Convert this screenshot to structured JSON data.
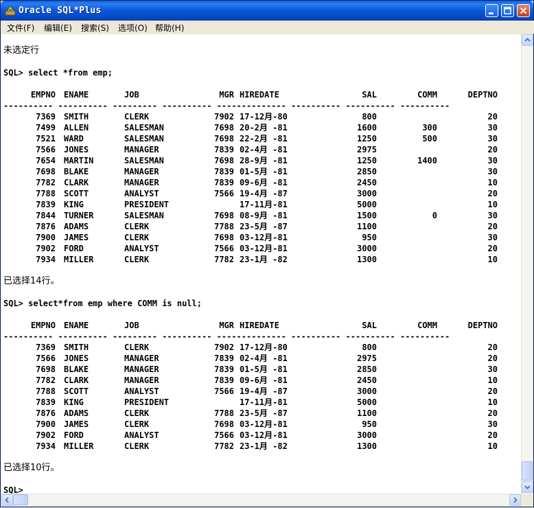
{
  "window": {
    "title": "Oracle SQL*Plus"
  },
  "menu": [
    {
      "label": "文件(F)"
    },
    {
      "label": "编辑(E)"
    },
    {
      "label": "搜索(S)"
    },
    {
      "label": "选项(O)"
    },
    {
      "label": "帮助(H)"
    }
  ],
  "console": {
    "no_rows_msg": "未选定行",
    "query1": "SQL> select *from emp;",
    "query2": "SQL> select*from emp where COMM is null;",
    "prompt": "SQL>",
    "separator": "---------- ---------- --------- ---------- -------------- ---------- ---------- ----------",
    "columns": [
      "EMPNO",
      "ENAME",
      "JOB",
      "MGR",
      "HIREDATE",
      "SAL",
      "COMM",
      "DEPTNO"
    ],
    "result1": [
      [
        "7369",
        "SMITH",
        "CLERK",
        "7902",
        "17-12月-80",
        "800",
        "",
        "20"
      ],
      [
        "7499",
        "ALLEN",
        "SALESMAN",
        "7698",
        "20-2月 -81",
        "1600",
        "300",
        "30"
      ],
      [
        "7521",
        "WARD",
        "SALESMAN",
        "7698",
        "22-2月 -81",
        "1250",
        "500",
        "30"
      ],
      [
        "7566",
        "JONES",
        "MANAGER",
        "7839",
        "02-4月 -81",
        "2975",
        "",
        "20"
      ],
      [
        "7654",
        "MARTIN",
        "SALESMAN",
        "7698",
        "28-9月 -81",
        "1250",
        "1400",
        "30"
      ],
      [
        "7698",
        "BLAKE",
        "MANAGER",
        "7839",
        "01-5月 -81",
        "2850",
        "",
        "30"
      ],
      [
        "7782",
        "CLARK",
        "MANAGER",
        "7839",
        "09-6月 -81",
        "2450",
        "",
        "10"
      ],
      [
        "7788",
        "SCOTT",
        "ANALYST",
        "7566",
        "19-4月 -87",
        "3000",
        "",
        "20"
      ],
      [
        "7839",
        "KING",
        "PRESIDENT",
        "",
        "17-11月-81",
        "5000",
        "",
        "10"
      ],
      [
        "7844",
        "TURNER",
        "SALESMAN",
        "7698",
        "08-9月 -81",
        "1500",
        "0",
        "30"
      ],
      [
        "7876",
        "ADAMS",
        "CLERK",
        "7788",
        "23-5月 -87",
        "1100",
        "",
        "20"
      ],
      [
        "7900",
        "JAMES",
        "CLERK",
        "7698",
        "03-12月-81",
        "950",
        "",
        "30"
      ],
      [
        "7902",
        "FORD",
        "ANALYST",
        "7566",
        "03-12月-81",
        "3000",
        "",
        "20"
      ],
      [
        "7934",
        "MILLER",
        "CLERK",
        "7782",
        "23-1月 -82",
        "1300",
        "",
        "10"
      ]
    ],
    "result1_msg": "已选择14行。",
    "result2": [
      [
        "7369",
        "SMITH",
        "CLERK",
        "7902",
        "17-12月-80",
        "800",
        "",
        "20"
      ],
      [
        "7566",
        "JONES",
        "MANAGER",
        "7839",
        "02-4月 -81",
        "2975",
        "",
        "20"
      ],
      [
        "7698",
        "BLAKE",
        "MANAGER",
        "7839",
        "01-5月 -81",
        "2850",
        "",
        "30"
      ],
      [
        "7782",
        "CLARK",
        "MANAGER",
        "7839",
        "09-6月 -81",
        "2450",
        "",
        "10"
      ],
      [
        "7788",
        "SCOTT",
        "ANALYST",
        "7566",
        "19-4月 -87",
        "3000",
        "",
        "20"
      ],
      [
        "7839",
        "KING",
        "PRESIDENT",
        "",
        "17-11月-81",
        "5000",
        "",
        "10"
      ],
      [
        "7876",
        "ADAMS",
        "CLERK",
        "7788",
        "23-5月 -87",
        "1100",
        "",
        "20"
      ],
      [
        "7900",
        "JAMES",
        "CLERK",
        "7698",
        "03-12月-81",
        "950",
        "",
        "30"
      ],
      [
        "7902",
        "FORD",
        "ANALYST",
        "7566",
        "03-12月-81",
        "3000",
        "",
        "20"
      ],
      [
        "7934",
        "MILLER",
        "CLERK",
        "7782",
        "23-1月 -82",
        "1300",
        "",
        "10"
      ]
    ],
    "result2_msg": "已选择10行。"
  },
  "icons": {
    "app": "oracle-sqlplus-icon",
    "minimize": "minimize-icon",
    "maximize": "maximize-icon",
    "close": "close-icon"
  },
  "colors": {
    "titlebar": "#0a58d8",
    "console_bg": "#ffffff",
    "close_button": "#c83c14"
  }
}
